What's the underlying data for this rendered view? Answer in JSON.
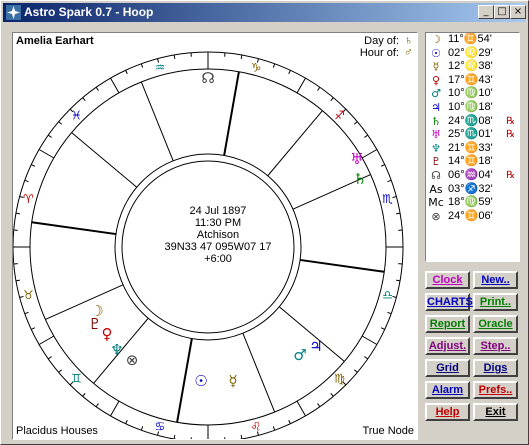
{
  "window": {
    "title": "Astro Spark 0.7 - Hoop",
    "controls": {
      "minimize": "_",
      "maximize": "□",
      "close": "×"
    }
  },
  "chart": {
    "name": "Amelia Earhart",
    "day_of_label": "Day of:",
    "day_of_glyph": "♄",
    "hour_of_label": "Hour of:",
    "hour_of_glyph": "♂",
    "center": {
      "date": "24 Jul 1897",
      "time": "11:30 PM",
      "place": "Atchison",
      "coords": "39N33 47 095W07 17",
      "tz": "+6:00"
    },
    "house_system": "Placidus Houses",
    "node_type": "True Node",
    "wheel_glyphs": [
      {
        "glyph": "♒",
        "color": "#008080"
      },
      {
        "glyph": "♑",
        "color": "#806000"
      },
      {
        "glyph": "♐",
        "color": "#c00000"
      },
      {
        "glyph": "♏",
        "color": "#0000c0"
      },
      {
        "glyph": "♎",
        "color": "#008080"
      },
      {
        "glyph": "♍",
        "color": "#806000"
      },
      {
        "glyph": "♌",
        "color": "#c00000"
      },
      {
        "glyph": "♋",
        "color": "#0000c0"
      },
      {
        "glyph": "♊",
        "color": "#008080"
      },
      {
        "glyph": "♉",
        "color": "#806000"
      },
      {
        "glyph": "♈",
        "color": "#c00000"
      },
      {
        "glyph": "♓",
        "color": "#0000c0"
      }
    ],
    "planet_glyphs": [
      {
        "glyph": "☊",
        "color": "#404040"
      },
      {
        "glyph": "♅",
        "color": "#c000c0"
      },
      {
        "glyph": "♄",
        "color": "#008000"
      },
      {
        "glyph": "♂",
        "color": "#008080"
      },
      {
        "glyph": "♃",
        "color": "#0000c0"
      },
      {
        "glyph": "☉",
        "color": "#0000c0"
      },
      {
        "glyph": "☿",
        "color": "#806000"
      },
      {
        "glyph": "☽",
        "color": "#806000"
      },
      {
        "glyph": "♇",
        "color": "#800000"
      },
      {
        "glyph": "♀",
        "color": "#c00000"
      },
      {
        "glyph": "♆",
        "color": "#008080"
      },
      {
        "glyph": "⊗",
        "color": "#404040"
      }
    ]
  },
  "positions": [
    {
      "glyph": "☽",
      "color": "#806000",
      "text": "11°♊54'",
      "retro": ""
    },
    {
      "glyph": "☉",
      "color": "#0000c0",
      "text": "02°♌29'",
      "retro": ""
    },
    {
      "glyph": "☿",
      "color": "#806000",
      "text": "12°♌38'",
      "retro": ""
    },
    {
      "glyph": "♀",
      "color": "#c00000",
      "text": "17°♊43'",
      "retro": ""
    },
    {
      "glyph": "♂",
      "color": "#008080",
      "text": "10°♍10'",
      "retro": ""
    },
    {
      "glyph": "♃",
      "color": "#0000c0",
      "text": "10°♍18'",
      "retro": ""
    },
    {
      "glyph": "♄",
      "color": "#008000",
      "text": "24°♏08'",
      "retro": "℞"
    },
    {
      "glyph": "♅",
      "color": "#c000c0",
      "text": "25°♏01'",
      "retro": "℞"
    },
    {
      "glyph": "♆",
      "color": "#008080",
      "text": "21°♊33'",
      "retro": ""
    },
    {
      "glyph": "♇",
      "color": "#800000",
      "text": "14°♊18'",
      "retro": ""
    },
    {
      "glyph": "☊",
      "color": "#404040",
      "text": "06°♒04'",
      "retro": "℞"
    },
    {
      "glyph": "As",
      "color": "#000000",
      "text": "03°♐32'",
      "retro": ""
    },
    {
      "glyph": "Mc",
      "color": "#000000",
      "text": "18°♍59'",
      "retro": ""
    },
    {
      "glyph": "⊗",
      "color": "#404040",
      "text": "24°♊06'",
      "retro": ""
    }
  ],
  "buttons": [
    {
      "label": "Clock",
      "color": "#c000c0",
      "name": "clock-button"
    },
    {
      "label": "New..",
      "color": "#0000c0",
      "name": "new-button"
    },
    {
      "label": "CHARTS",
      "color": "#0000c0",
      "name": "charts-button"
    },
    {
      "label": "Print..",
      "color": "#008000",
      "name": "print-button"
    },
    {
      "label": "Report",
      "color": "#008000",
      "name": "report-button"
    },
    {
      "label": "Oracle",
      "color": "#008000",
      "name": "oracle-button"
    },
    {
      "label": "Adjust.",
      "color": "#800080",
      "name": "adjust-button"
    },
    {
      "label": "Step..",
      "color": "#800080",
      "name": "step-button"
    },
    {
      "label": "Grid",
      "color": "#000080",
      "name": "grid-button"
    },
    {
      "label": "Digs",
      "color": "#000080",
      "name": "digs-button"
    },
    {
      "label": "Alarm",
      "color": "#0000c0",
      "name": "alarm-button"
    },
    {
      "label": "Prefs..",
      "color": "#c00000",
      "name": "prefs-button"
    },
    {
      "label": "Help",
      "color": "#c00000",
      "name": "help-button"
    },
    {
      "label": "Exit",
      "color": "#000000",
      "name": "exit-button"
    }
  ]
}
